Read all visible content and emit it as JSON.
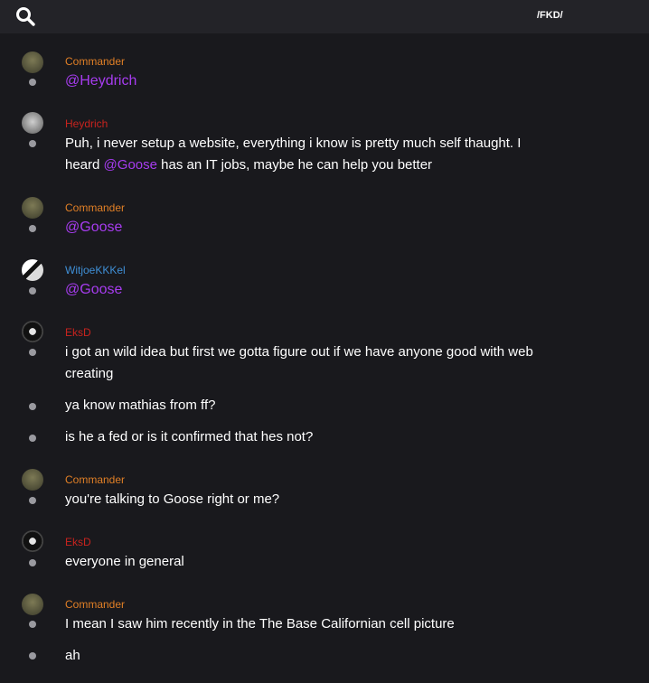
{
  "header": {
    "channel": "/FKD/",
    "search_icon": "search-icon"
  },
  "colors": {
    "commander": "#e07f26",
    "heydrich": "#c8231e",
    "witjoe": "#3f8fd6",
    "eksd": "#c8231e",
    "mention": "#a73cf0"
  },
  "messages": [
    {
      "author": "Commander",
      "mention": "@Heydrich"
    },
    {
      "author": "Heydrich",
      "text_a": "Puh, i never setup a website, everything i know is pretty much self thaught. I",
      "text_b": "heard ",
      "mention": "@Goose",
      "text_c": " has an IT jobs, maybe he can help you better"
    },
    {
      "author": "Commander",
      "mention": "@Goose"
    },
    {
      "author": "WitjoeKKKel",
      "mention": "@Goose"
    },
    {
      "author": "EksD",
      "lines": [
        "i got an wild idea but first we gotta figure out if we have anyone good with web",
        "creating",
        "ya know mathias from ff?",
        "is he a fed or is it confirmed that hes not?"
      ]
    },
    {
      "author": "Commander",
      "text": "you're talking to Goose right or me?"
    },
    {
      "author": "EksD",
      "text": "everyone in general"
    },
    {
      "author": "Commander",
      "lines": [
        "I mean I saw him recently in the The Base Californian cell picture",
        "ah"
      ]
    }
  ]
}
